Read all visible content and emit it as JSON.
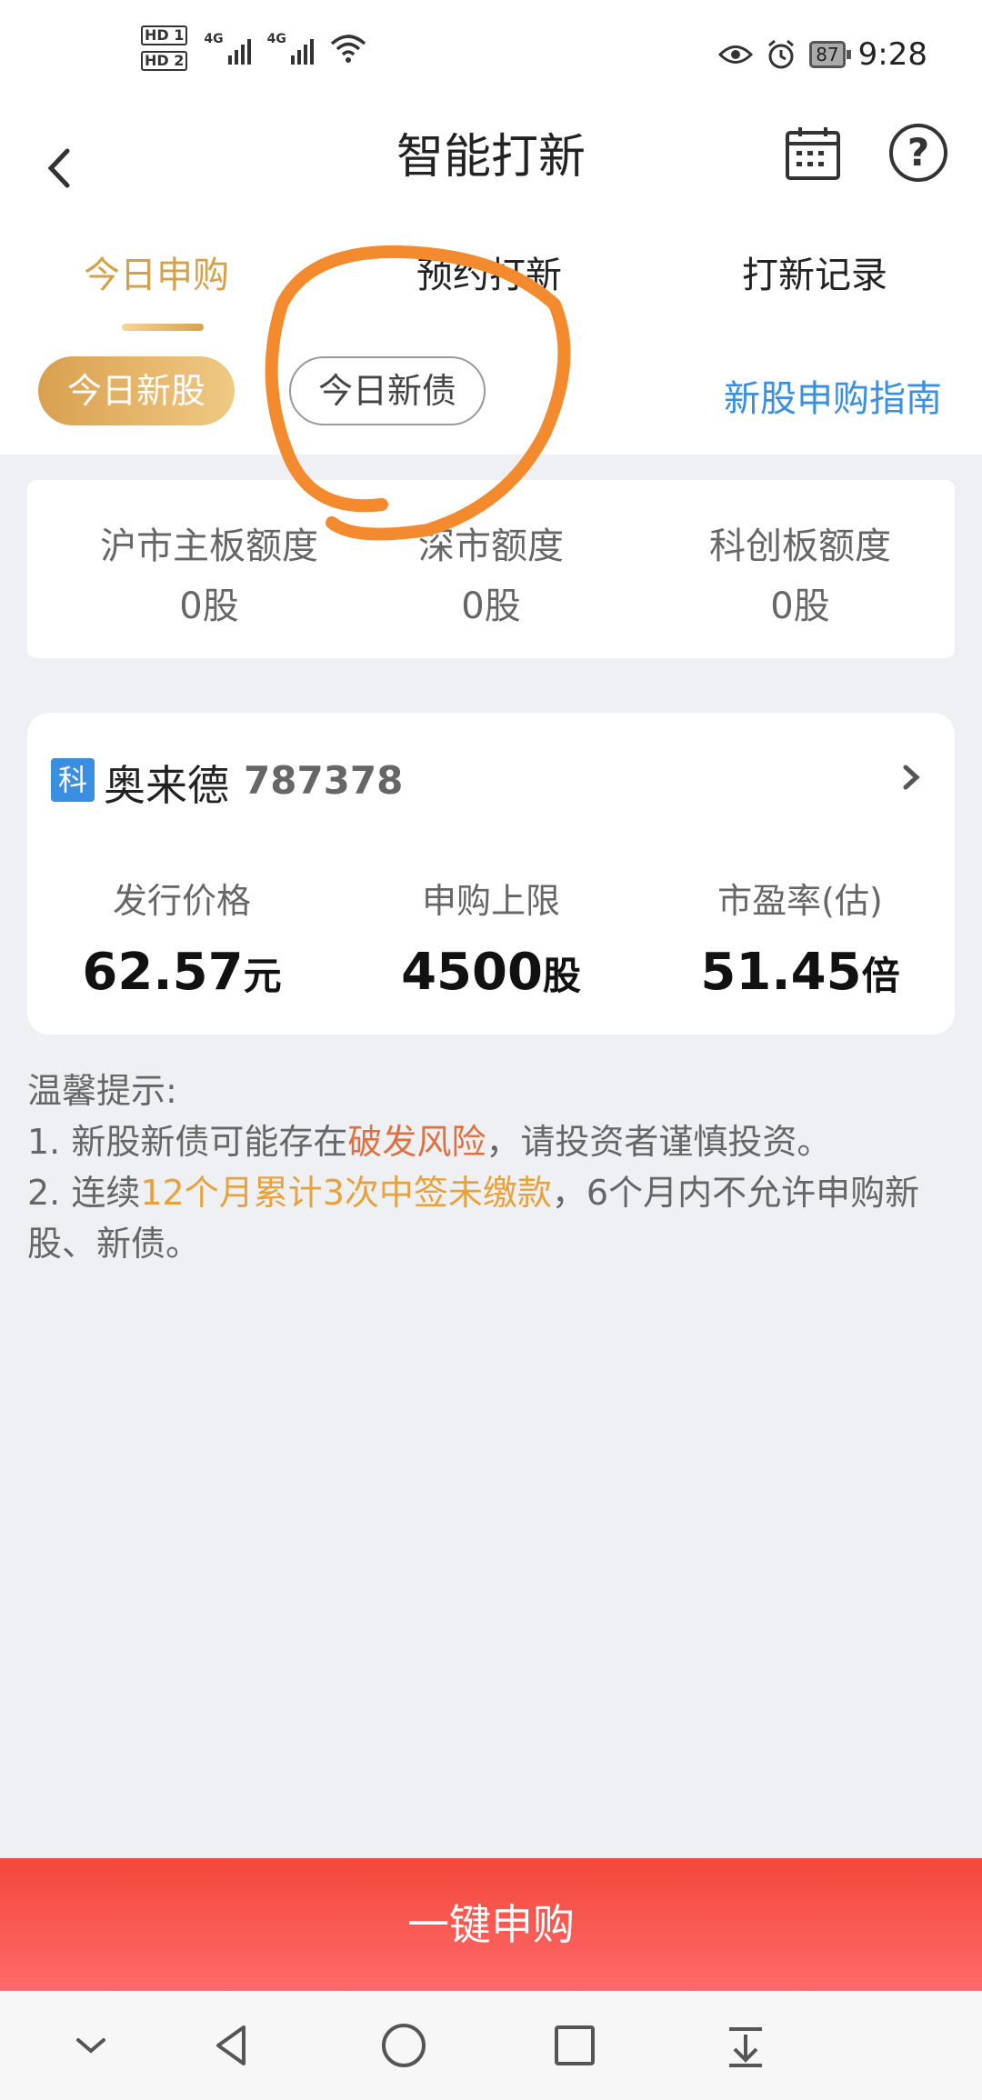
{
  "status_bar": {
    "hd1": "HD 1",
    "hd2": "HD 2",
    "net1": "4G",
    "net2": "4G",
    "battery": "87",
    "time": "9:28"
  },
  "header": {
    "title": "智能打新"
  },
  "tabs": [
    "今日申购",
    "预约打新",
    "打新记录"
  ],
  "chips": {
    "active": "今日新股",
    "other": "今日新债",
    "guide": "新股申购指南"
  },
  "quota": [
    {
      "label": "沪市主板额度",
      "value": "0股"
    },
    {
      "label": "深市额度",
      "value": "0股"
    },
    {
      "label": "科创板额度",
      "value": "0股"
    }
  ],
  "stock": {
    "badge": "科",
    "name": "奥来德",
    "code": "787378",
    "metrics": [
      {
        "label": "发行价格",
        "value": "62.57",
        "unit": "元"
      },
      {
        "label": "申购上限",
        "value": "4500",
        "unit": "股"
      },
      {
        "label": "市盈率(估)",
        "value": "51.45",
        "unit": "倍"
      }
    ]
  },
  "tips": {
    "title": "温馨提示:",
    "line1_a": "1. 新股新债可能存在",
    "line1_hl": "破发风险",
    "line1_b": "，请投资者谨慎投资。",
    "line2_a": "2. 连续",
    "line2_hl": "12个月累计3次中签未缴款",
    "line2_b": "，6个月内不允许申购新股、新债。"
  },
  "action": {
    "label": "一键申购"
  },
  "colors": {
    "accent_gold": "#d4a04a",
    "link_blue": "#3a8fe0",
    "action_red": "#f3483b",
    "annotation_orange": "#f38a2e"
  },
  "icons": [
    "back-icon",
    "calendar-icon",
    "help-icon",
    "chevron-right-icon",
    "nav-collapse-icon",
    "nav-back-icon",
    "nav-home-icon",
    "nav-recents-icon",
    "nav-download-icon"
  ]
}
